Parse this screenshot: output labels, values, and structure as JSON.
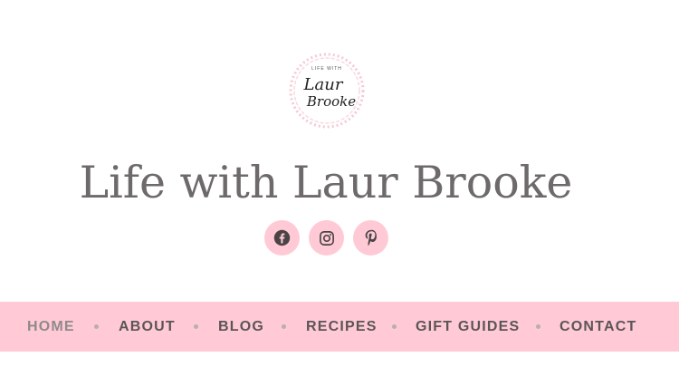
{
  "logo": {
    "small_text": "LIFE WITH",
    "line1": "Laur",
    "line2": "Brooke"
  },
  "site_title": "Life with Laur Brooke",
  "socials": [
    {
      "name": "Facebook",
      "icon": "facebook-icon"
    },
    {
      "name": "Instagram",
      "icon": "instagram-icon"
    },
    {
      "name": "Pinterest",
      "icon": "pinterest-icon"
    }
  ],
  "nav": {
    "items": [
      {
        "label": "HOME",
        "active": true
      },
      {
        "label": "ABOUT",
        "active": false
      },
      {
        "label": "BLOG",
        "active": false
      },
      {
        "label": "RECIPES",
        "active": false
      },
      {
        "label": "GIFT GUIDES",
        "active": false
      },
      {
        "label": "CONTACT",
        "active": false
      }
    ]
  },
  "colors": {
    "accent_pink": "#ffcad6",
    "nav_text": "#5b5557",
    "nav_active": "#8f8a8b",
    "title_text": "#6e6a6b"
  }
}
